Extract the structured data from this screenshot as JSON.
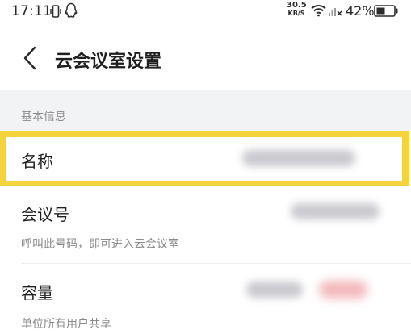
{
  "status_bar": {
    "time": "17:11",
    "net_speed_value": "30.5",
    "net_speed_unit": "KB/S",
    "battery_percent": "42%",
    "icons": [
      "vibrate-icon",
      "qq-icon",
      "wifi-icon",
      "signal-icon",
      "battery-icon"
    ]
  },
  "header": {
    "title": "云会议室设置",
    "back_icon": "chevron-left-icon"
  },
  "section": {
    "title": "基本信息"
  },
  "rows": [
    {
      "label": "名称",
      "value_hidden": true
    },
    {
      "label": "会议号",
      "subtitle": "呼叫此号码，即可进入云会议室",
      "value_hidden": true
    },
    {
      "label": "容量",
      "subtitle": "单位所有用户共享",
      "value_hidden": true
    }
  ],
  "colors": {
    "highlight": "#f5d33c",
    "section_bg": "#f2f3f5",
    "secondary_text": "#8a8a8a"
  }
}
